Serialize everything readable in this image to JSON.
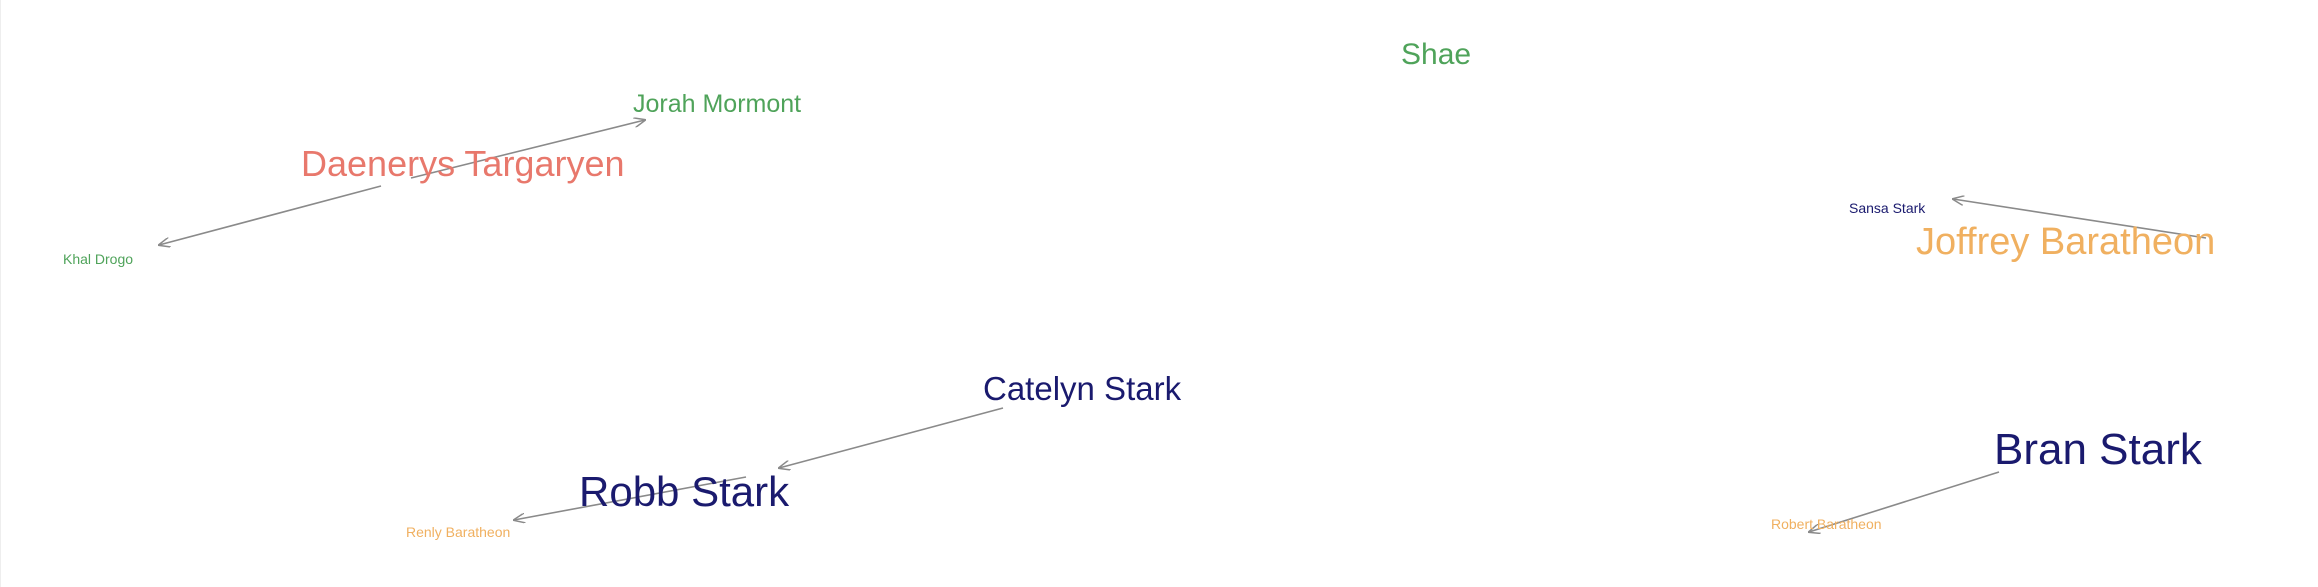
{
  "colors": {
    "stark": "#1a1a6e",
    "targaryen": "#e8786c",
    "baratheon": "#f0b060",
    "other": "#4fa35a",
    "edge": "#8a8a8a"
  },
  "nodes": [
    {
      "id": "shae",
      "label": "Shae",
      "group": "other"
    },
    {
      "id": "jorah",
      "label": "Jorah Mormont",
      "group": "other"
    },
    {
      "id": "daenerys",
      "label": "Daenerys Targaryen",
      "group": "targaryen"
    },
    {
      "id": "khal",
      "label": "Khal Drogo",
      "group": "other"
    },
    {
      "id": "sansa",
      "label": "Sansa Stark",
      "group": "stark"
    },
    {
      "id": "joffrey",
      "label": "Joffrey Baratheon",
      "group": "baratheon"
    },
    {
      "id": "catelyn",
      "label": "Catelyn Stark",
      "group": "stark"
    },
    {
      "id": "robb",
      "label": "Robb Stark",
      "group": "stark"
    },
    {
      "id": "renly",
      "label": "Renly Baratheon",
      "group": "baratheon"
    },
    {
      "id": "bran",
      "label": "Bran Stark",
      "group": "stark"
    },
    {
      "id": "robert",
      "label": "Robert Baratheon",
      "group": "baratheon"
    }
  ],
  "edges": [
    {
      "from": "daenerys",
      "to": "jorah"
    },
    {
      "from": "daenerys",
      "to": "khal"
    },
    {
      "from": "joffrey",
      "to": "sansa"
    },
    {
      "from": "catelyn",
      "to": "robb"
    },
    {
      "from": "robb",
      "to": "renly"
    },
    {
      "from": "bran",
      "to": "robert"
    }
  ]
}
